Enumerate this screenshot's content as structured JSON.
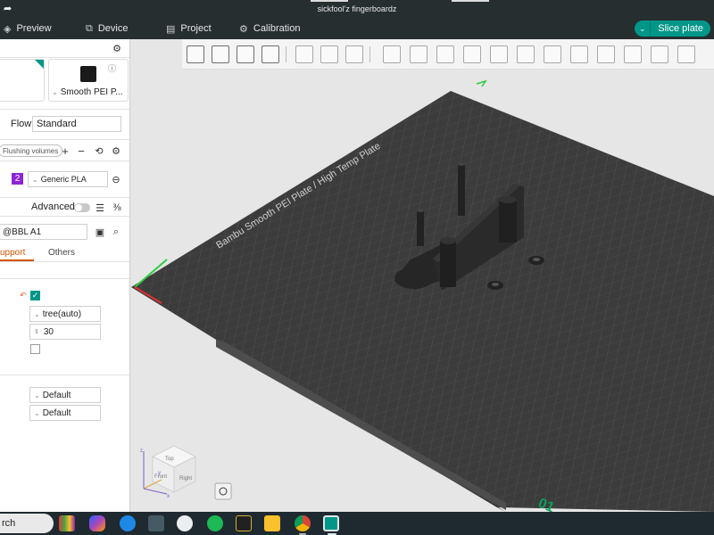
{
  "window": {
    "title": "sickfool'z fingerboardz"
  },
  "nav": {
    "preview": "Preview",
    "device": "Device",
    "project": "Project",
    "calibration": "Calibration",
    "slice_plate": "Slice plate"
  },
  "left_panel": {
    "plate_type": "Smooth PEI P...",
    "flow_label": "Flow",
    "flow_value": "Standard",
    "flushing_volumes": "Flushing volumes",
    "filament_index": "2",
    "filament_name": "Generic PLA",
    "advanced_label": "Advanced",
    "process_preset": "@BBL A1",
    "tabs": {
      "support": "upport",
      "others": "Others"
    },
    "support_type": "tree(auto)",
    "threshold_angle": "30",
    "setting_default_1": "Default",
    "setting_default_2": "Default"
  },
  "viewport": {
    "bed_label": "Bambu Smooth PEI Plate / High Temp Plate",
    "plate_number": "01",
    "cube_labels": {
      "top": "Top",
      "front": "Front",
      "right": "Right"
    },
    "axis_labels": {
      "x": "x",
      "y": "y",
      "z": "z"
    }
  },
  "taskbar": {
    "search": "rch"
  },
  "colors": {
    "accent": "#009688",
    "bed": "#3c3c3c",
    "model": "#262626",
    "titlebar": "#262e30",
    "support_tab": "#d35400"
  }
}
